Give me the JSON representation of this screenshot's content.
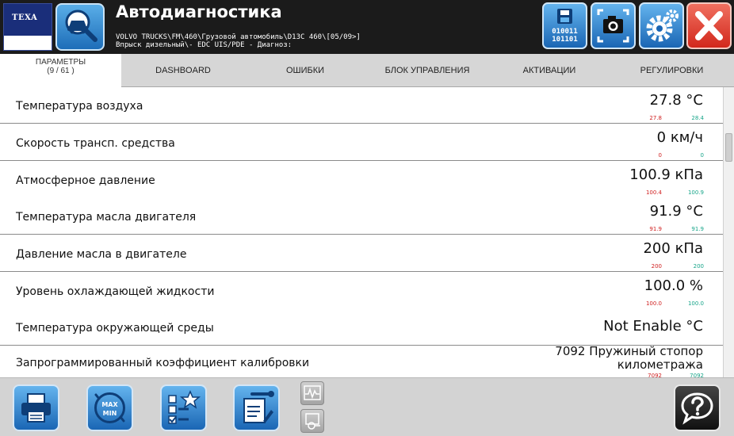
{
  "header": {
    "logo_text": "TEXA",
    "title": "Автодиагностика",
    "subtitle_line1": "VOLVO TRUCKS\\FM\\460\\Грузовой автомобиль\\D13C 460\\[05/09>]",
    "subtitle_line2": "Впрыск дизельный\\- EDC UIS/PDE - Диагноз:",
    "save_icon_text_1": "010011",
    "save_icon_text_2": "101101"
  },
  "tabs": {
    "params_label": "ПАРАМЕТРЫ",
    "params_count": "(9 / 61 )",
    "items": [
      {
        "label": "DASHBOARD"
      },
      {
        "label": "ОШИБКИ"
      },
      {
        "label": "БЛОК УПРАВЛЕНИЯ"
      },
      {
        "label": "АКТИВАЦИИ"
      },
      {
        "label": "РЕГУЛИРОВКИ"
      }
    ]
  },
  "parameters": [
    {
      "label": "Температура воздуха",
      "value": "27.8 °C",
      "min": "27.8",
      "max": "28.4"
    },
    {
      "label": "Скорость трансп. средства",
      "value": "0 км/ч",
      "min": "0",
      "max": "0"
    },
    {
      "label": "Атмосферное давление",
      "value": "100.9 кПа",
      "min": "100.4",
      "max": "100.9"
    },
    {
      "label": "Температура масла двигателя",
      "value": "91.9 °C",
      "min": "91.9",
      "max": "91.9"
    },
    {
      "label": "Давление масла в двигателе",
      "value": "200 кПа",
      "min": "200",
      "max": "200"
    },
    {
      "label": "Уровень охлаждающей жидкости",
      "value": "100.0 %",
      "min": "100.0",
      "max": "100.0"
    },
    {
      "label": "Температура окружающей среды",
      "value": "Not Enable °C",
      "min": "",
      "max": ""
    },
    {
      "label": "Запрограммированный коэффициент калибровки",
      "value_line1": "7092 Пружиный стопор",
      "value_line2": "километража",
      "min": "7092",
      "max": "7092"
    }
  ],
  "colors": {
    "header_bg": "#1b1b1b",
    "button_blue": "#1a66b4",
    "close_red": "#d2281c",
    "min_value": "#d02020",
    "max_value": "#17a589"
  },
  "icons": {
    "header": [
      "search-car-icon",
      "save-data-icon",
      "screenshot-icon",
      "settings-gear-icon",
      "close-icon"
    ],
    "footer": [
      "printer-icon",
      "max-min-icon",
      "checklist-star-icon",
      "report-wrench-icon",
      "graph-icon",
      "component-icon",
      "help-icon"
    ]
  },
  "footer": {
    "maxmin_max": "MAX",
    "maxmin_min": "MIN"
  }
}
